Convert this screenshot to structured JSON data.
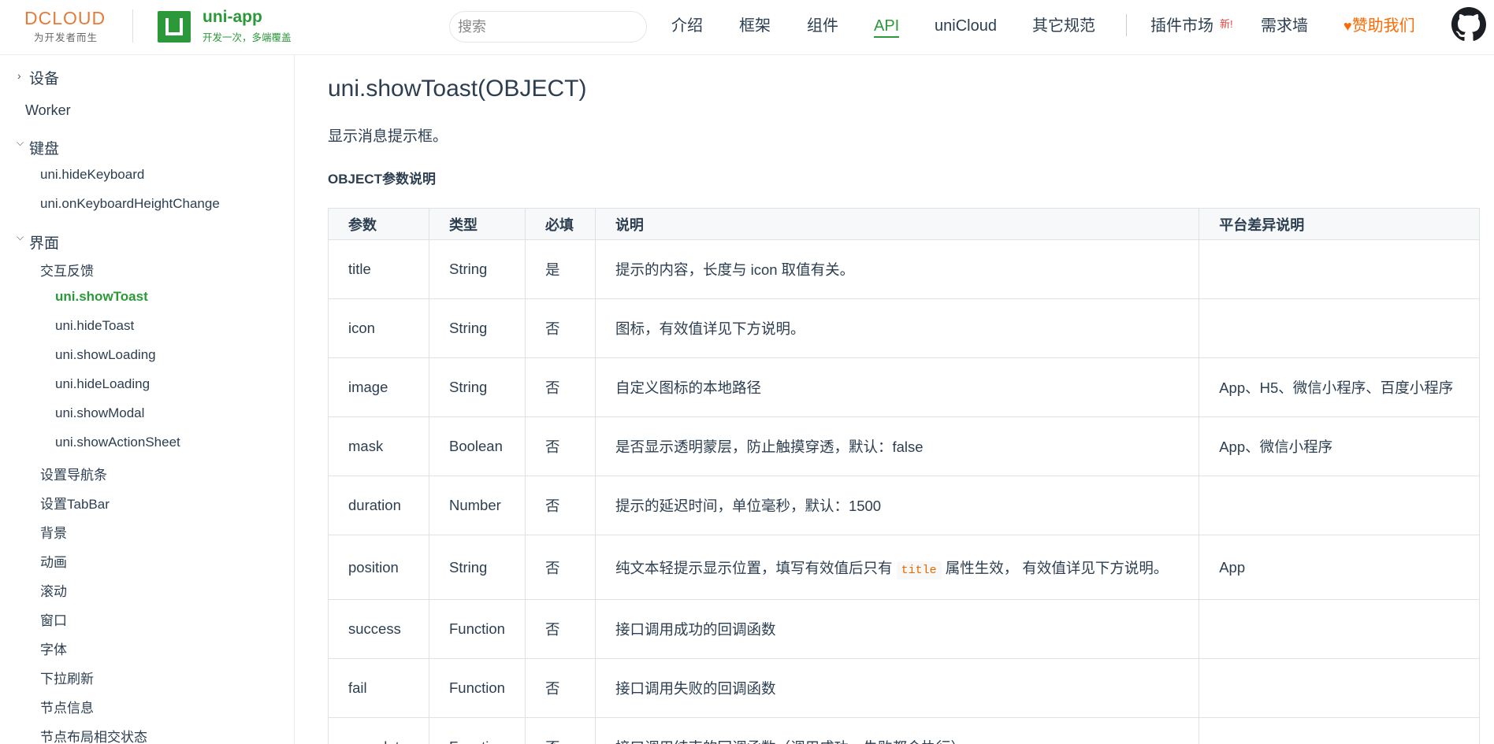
{
  "header": {
    "dcloud_logo_mark": "DCLOUD",
    "dcloud_slogan": "为开发者而生",
    "product_name": "uni-app",
    "product_slogan": "开发一次，多端覆盖",
    "search_placeholder": "搜索",
    "nav": {
      "intro": "介绍",
      "framework": "框架",
      "components": "组件",
      "api": "API",
      "unicloud": "uniCloud",
      "other": "其它规范",
      "plugin_market": "插件市场",
      "new_badge": "新!",
      "wishwall": "需求墙",
      "sponsor": "赞助我们"
    },
    "accent_color": "#2b9939",
    "sponsor_color": "#ff6a00"
  },
  "sidebar": {
    "group_device": "设备",
    "worker": "Worker",
    "group_keyboard": "键盘",
    "hide_keyboard": "uni.hideKeyboard",
    "on_keyboard_height_change": "uni.onKeyboardHeightChange",
    "group_ui": "界面",
    "interaction_feedback": "交互反馈",
    "show_toast": "uni.showToast",
    "hide_toast": "uni.hideToast",
    "show_loading": "uni.showLoading",
    "hide_loading": "uni.hideLoading",
    "show_modal": "uni.showModal",
    "show_action_sheet": "uni.showActionSheet",
    "navbar": "设置导航条",
    "tabbar": "设置TabBar",
    "background": "背景",
    "animation": "动画",
    "scroll": "滚动",
    "window": "窗口",
    "font": "字体",
    "pull_refresh": "下拉刷新",
    "node_info": "节点信息",
    "node_layout": "节点布局相交状态"
  },
  "main": {
    "title": "uni.showToast(OBJECT)",
    "description": "显示消息提示框。",
    "section_title": "OBJECT参数说明",
    "table": {
      "headers": {
        "param": "参数",
        "type": "类型",
        "required": "必填",
        "desc": "说明",
        "platform": "平台差异说明"
      },
      "rows": [
        {
          "param": "title",
          "type": "String",
          "required": "是",
          "desc": "提示的内容，长度与 icon 取值有关。",
          "platform": ""
        },
        {
          "param": "icon",
          "type": "String",
          "required": "否",
          "desc": "图标，有效值详见下方说明。",
          "platform": ""
        },
        {
          "param": "image",
          "type": "String",
          "required": "否",
          "desc": "自定义图标的本地路径",
          "platform": "App、H5、微信小程序、百度小程序"
        },
        {
          "param": "mask",
          "type": "Boolean",
          "required": "否",
          "desc": "是否显示透明蒙层，防止触摸穿透，默认：false",
          "platform": "App、微信小程序"
        },
        {
          "param": "duration",
          "type": "Number",
          "required": "否",
          "desc": "提示的延迟时间，单位毫秒，默认：1500",
          "platform": ""
        },
        {
          "param": "position",
          "type": "String",
          "required": "否",
          "desc_before": "纯文本轻提示显示位置，填写有效值后只有",
          "desc_code": "title",
          "desc_after": "属性生效， 有效值详见下方说明。",
          "platform": "App"
        },
        {
          "param": "success",
          "type": "Function",
          "required": "否",
          "desc": "接口调用成功的回调函数",
          "platform": ""
        },
        {
          "param": "fail",
          "type": "Function",
          "required": "否",
          "desc": "接口调用失败的回调函数",
          "platform": ""
        },
        {
          "param": "complete",
          "type": "Function",
          "required": "否",
          "desc": "接口调用结束的回调函数（调用成功、失败都会执行）",
          "platform": ""
        }
      ]
    }
  }
}
